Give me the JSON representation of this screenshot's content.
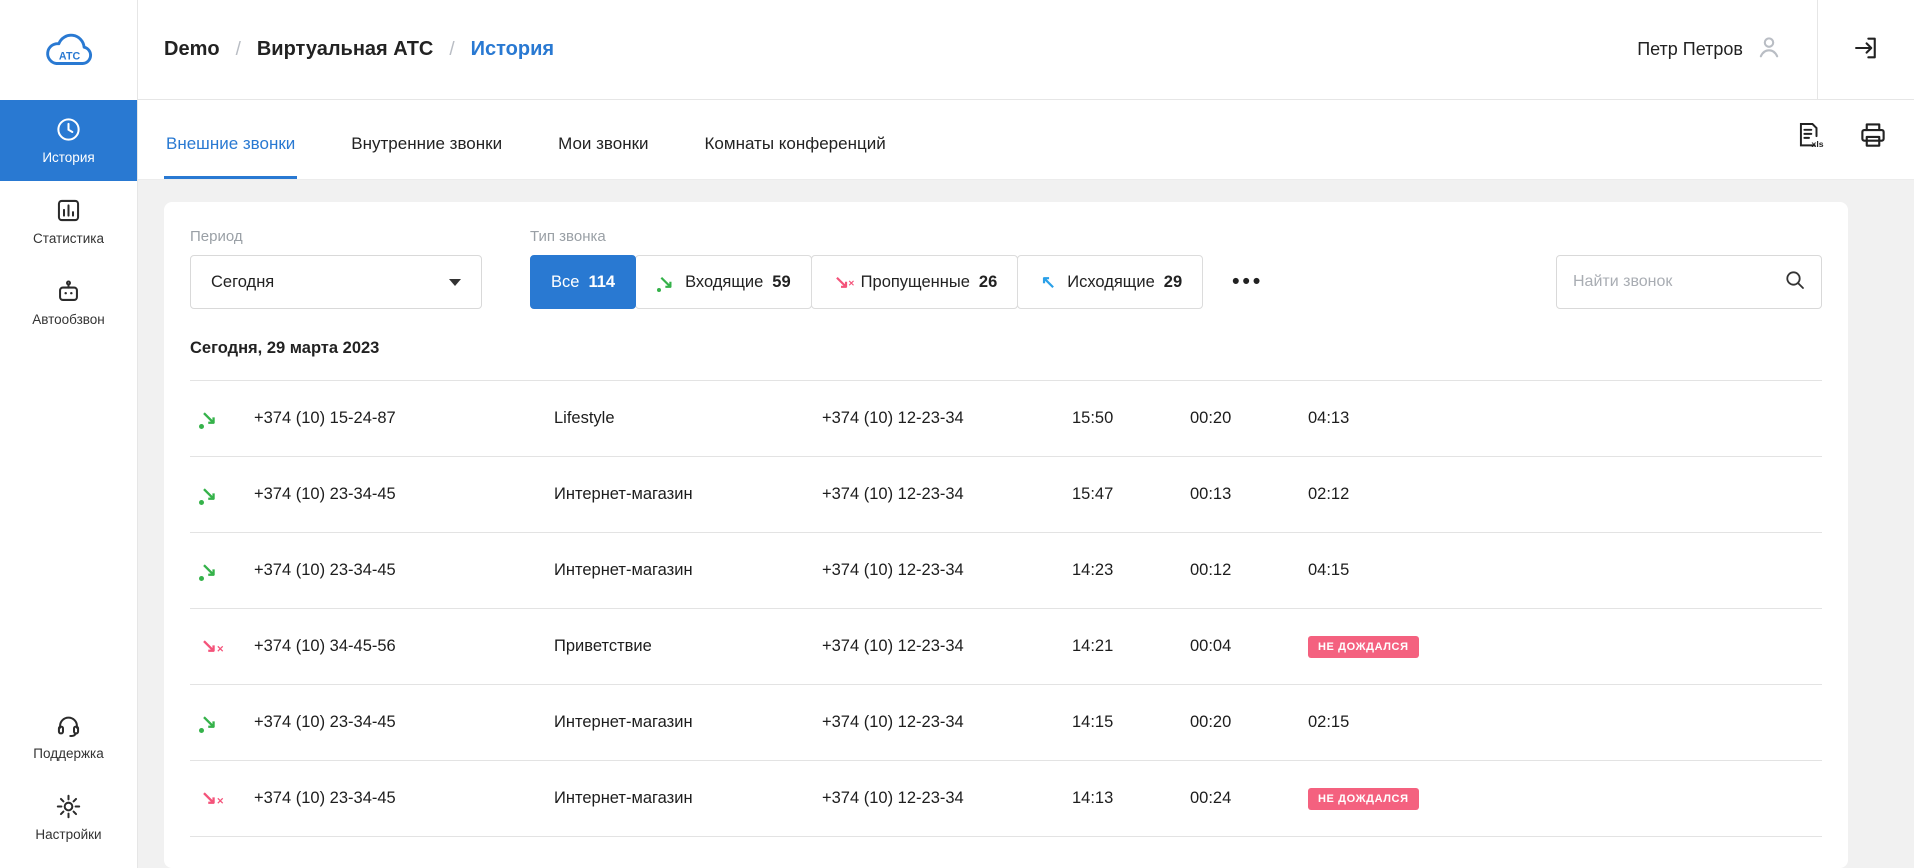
{
  "colors": {
    "primary": "#2979d2",
    "green": "#35b24a",
    "red": "#f4537a",
    "badge_bg": "#f4617f"
  },
  "sidebar": {
    "logo_text": "АТС",
    "items": [
      {
        "label": "История"
      },
      {
        "label": "Статистика"
      },
      {
        "label": "Автообзвон"
      },
      {
        "label": "Поддержка"
      },
      {
        "label": "Настройки"
      }
    ]
  },
  "header": {
    "breadcrumb": [
      "Demo",
      "Виртуальная АТС",
      "История"
    ],
    "separator": "/",
    "user_name": "Петр Петров"
  },
  "tabs": [
    {
      "label": "Внешние звонки"
    },
    {
      "label": "Внутренние звонки"
    },
    {
      "label": "Мои звонки"
    },
    {
      "label": "Комнаты конференций"
    }
  ],
  "filters": {
    "period_label": "Период",
    "period_value": "Сегодня",
    "type_label": "Тип звонка",
    "buttons": [
      {
        "label": "Все",
        "count": "114"
      },
      {
        "label": "Входящие",
        "count": "59",
        "icon": "in"
      },
      {
        "label": "Пропущенные",
        "count": "26",
        "icon": "missed"
      },
      {
        "label": "Исходящие",
        "count": "29",
        "icon": "out"
      }
    ],
    "more_label": "•••",
    "search_placeholder": "Найти звонок"
  },
  "table": {
    "date_header": "Сегодня, 29 марта 2023",
    "rows": [
      {
        "type": "in",
        "from": "+374 (10) 15-24-87",
        "name": "Lifestyle",
        "to": "+374 (10) 12-23-34",
        "time": "15:50",
        "wait": "00:20",
        "duration": "04:13"
      },
      {
        "type": "in",
        "from": "+374 (10) 23-34-45",
        "name": "Интернет-магазин",
        "to": "+374 (10) 12-23-34",
        "time": "15:47",
        "wait": "00:13",
        "duration": "02:12"
      },
      {
        "type": "in",
        "from": "+374 (10) 23-34-45",
        "name": "Интернет-магазин",
        "to": "+374 (10) 12-23-34",
        "time": "14:23",
        "wait": "00:12",
        "duration": "04:15"
      },
      {
        "type": "missed",
        "from": "+374 (10) 34-45-56",
        "name": "Приветствие",
        "to": "+374 (10) 12-23-34",
        "time": "14:21",
        "wait": "00:04",
        "badge": "не дождался"
      },
      {
        "type": "in",
        "from": "+374 (10) 23-34-45",
        "name": "Интернет-магазин",
        "to": "+374 (10) 12-23-34",
        "time": "14:15",
        "wait": "00:20",
        "duration": "02:15"
      },
      {
        "type": "missed",
        "from": "+374 (10) 23-34-45",
        "name": "Интернет-магазин",
        "to": "+374 (10) 12-23-34",
        "time": "14:13",
        "wait": "00:24",
        "badge": "не дождался"
      }
    ]
  }
}
